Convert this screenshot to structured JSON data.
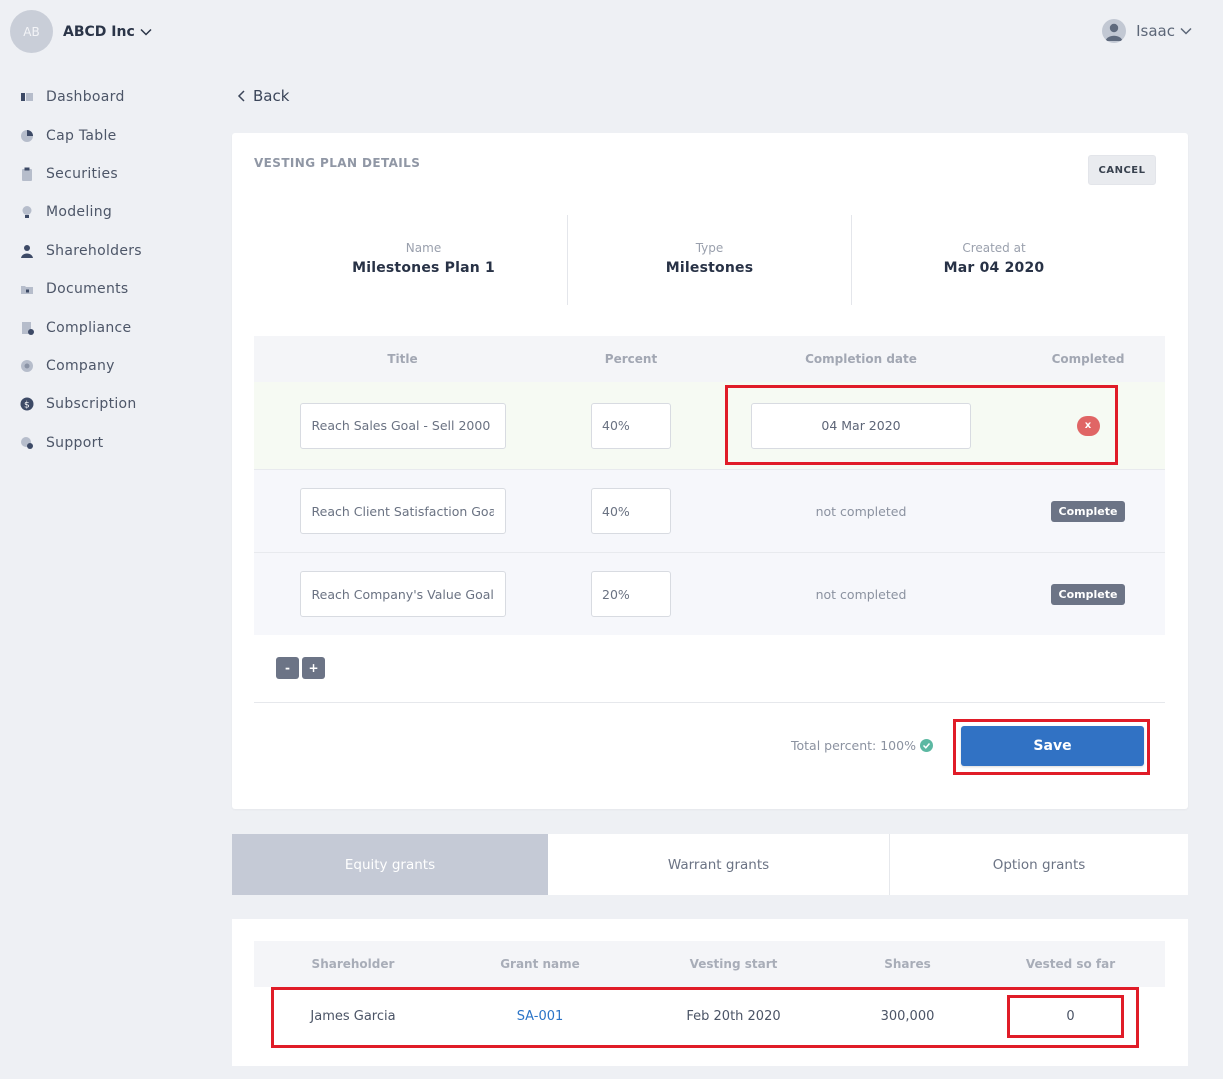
{
  "header": {
    "company_initials": "AB",
    "company_name": "ABCD Inc",
    "user_name": "Isaac"
  },
  "sidebar": {
    "items": [
      {
        "label": "Dashboard",
        "icon": "dashboard-icon"
      },
      {
        "label": "Cap Table",
        "icon": "pie-chart-icon"
      },
      {
        "label": "Securities",
        "icon": "clipboard-icon"
      },
      {
        "label": "Modeling",
        "icon": "lightbulb-icon"
      },
      {
        "label": "Shareholders",
        "icon": "person-icon"
      },
      {
        "label": "Documents",
        "icon": "folder-icon"
      },
      {
        "label": "Compliance",
        "icon": "document-check-icon"
      },
      {
        "label": "Company",
        "icon": "company-icon"
      },
      {
        "label": "Subscription",
        "icon": "dollar-icon"
      },
      {
        "label": "Support",
        "icon": "support-icon"
      }
    ]
  },
  "nav": {
    "back_label": "Back"
  },
  "plan": {
    "section_title": "VESTING PLAN DETAILS",
    "cancel_label": "CANCEL",
    "summary": {
      "name_label": "Name",
      "name_value": "Milestones Plan 1",
      "type_label": "Type",
      "type_value": "Milestones",
      "created_label": "Created at",
      "created_value": "Mar 04 2020"
    },
    "table_headers": {
      "title": "Title",
      "percent": "Percent",
      "completion_date": "Completion date",
      "completed": "Completed"
    },
    "milestones": [
      {
        "title": "Reach Sales Goal - Sell 2000",
        "percent": "40%",
        "completion_date": "04 Mar 2020",
        "completed_action": "x"
      },
      {
        "title": "Reach Client Satisfaction Goal",
        "percent": "40%",
        "completion_date": "not completed",
        "completed_action": "Complete"
      },
      {
        "title": "Reach Company's Value Goal",
        "percent": "20%",
        "completion_date": "not completed",
        "completed_action": "Complete"
      }
    ],
    "remove_label": "-",
    "add_label": "+",
    "total_percent": "Total percent: 100%",
    "save_label": "Save"
  },
  "tabs": [
    {
      "label": "Equity grants",
      "active": true
    },
    {
      "label": "Warrant grants",
      "active": false
    },
    {
      "label": "Option grants",
      "active": false
    }
  ],
  "grants": {
    "headers": {
      "shareholder": "Shareholder",
      "grant_name": "Grant name",
      "vesting_start": "Vesting start",
      "shares": "Shares",
      "vested_so_far": "Vested so far"
    },
    "rows": [
      {
        "shareholder": "James Garcia",
        "grant_name": "SA-001",
        "vesting_start": "Feb 20th 2020",
        "shares": "300,000",
        "vested_so_far": "0"
      }
    ]
  },
  "colors": {
    "primary": "#3172c4",
    "highlight": "#e01c28",
    "danger": "#e06565",
    "success": "#5cb8a2",
    "active_tab": "#c5cad6"
  }
}
